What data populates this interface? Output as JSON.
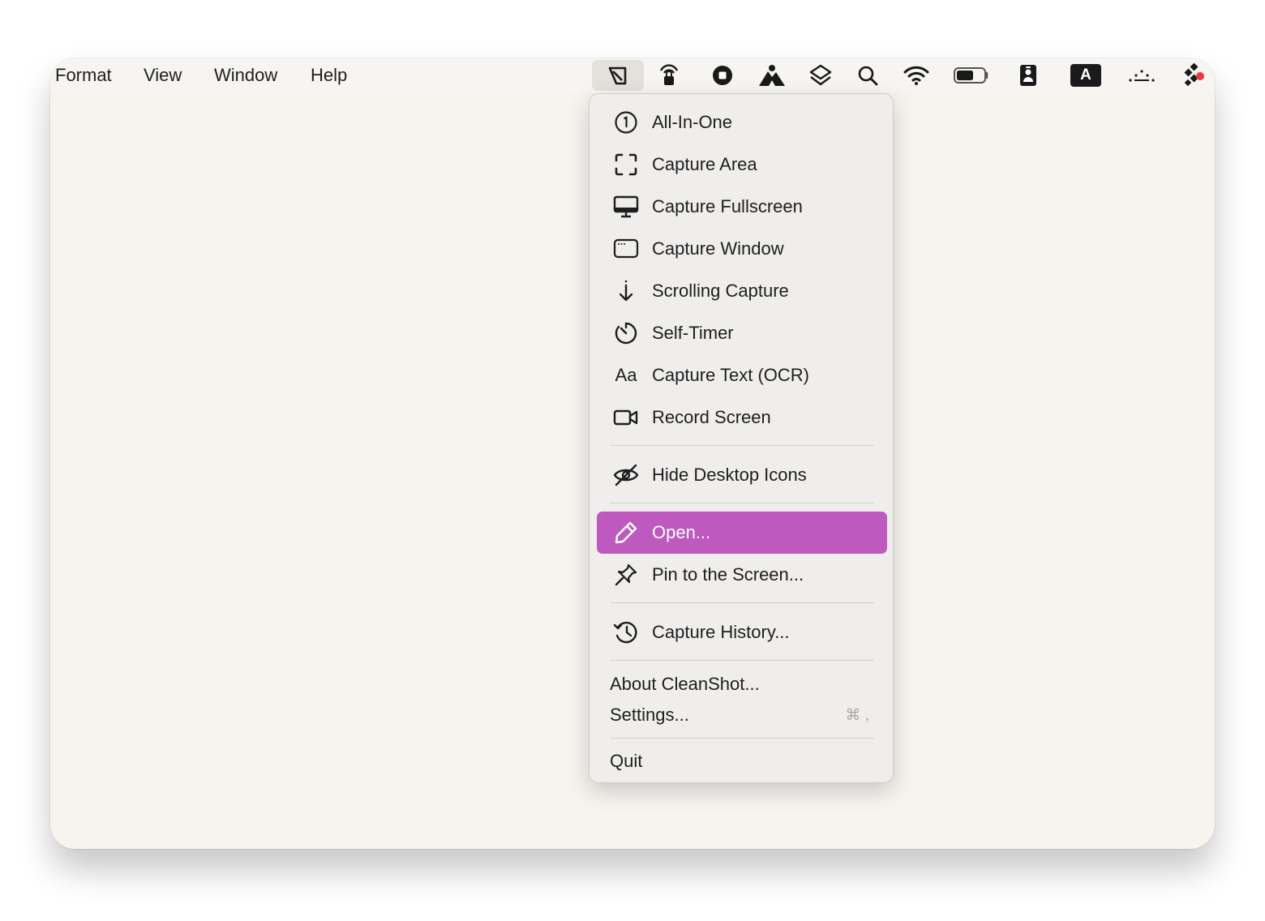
{
  "menubar": {
    "menus": [
      "Format",
      "View",
      "Window",
      "Help"
    ],
    "status_icons": [
      "cleanshot-icon",
      "broadcast-lock-icon",
      "record-stop-icon",
      "mountain-icon",
      "layers-icon",
      "search-icon",
      "wifi-icon",
      "battery-icon",
      "id-badge-icon",
      "keyboard-input-icon",
      "control-center-icon",
      "colorful-grid-icon"
    ],
    "input_source_label": "A"
  },
  "menu": {
    "items": [
      {
        "label": "All-In-One",
        "icon": "circled-one-icon"
      },
      {
        "label": "Capture Area",
        "icon": "capture-area-icon"
      },
      {
        "label": "Capture Fullscreen",
        "icon": "monitor-icon"
      },
      {
        "label": "Capture Window",
        "icon": "window-icon"
      },
      {
        "label": "Scrolling Capture",
        "icon": "arrow-down-icon"
      },
      {
        "label": "Self-Timer",
        "icon": "timer-icon"
      },
      {
        "label": "Capture Text (OCR)",
        "icon": "text-aa-icon",
        "icon_text": "Aa"
      },
      {
        "label": "Record Screen",
        "icon": "video-camera-icon"
      },
      {
        "label": "Hide Desktop Icons",
        "icon": "eye-slash-icon"
      },
      {
        "label": "Open...",
        "icon": "pencil-icon",
        "highlighted": true
      },
      {
        "label": "Pin to the Screen...",
        "icon": "pin-icon"
      },
      {
        "label": "Capture History...",
        "icon": "history-icon"
      },
      {
        "label": "About CleanShot..."
      },
      {
        "label": "Settings...",
        "shortcut": "⌘ ,"
      },
      {
        "label": "Quit"
      }
    ]
  },
  "colors": {
    "highlight": "#bd59bf",
    "menu_background": "#efeeec",
    "window_background": "#f7f4f0"
  }
}
